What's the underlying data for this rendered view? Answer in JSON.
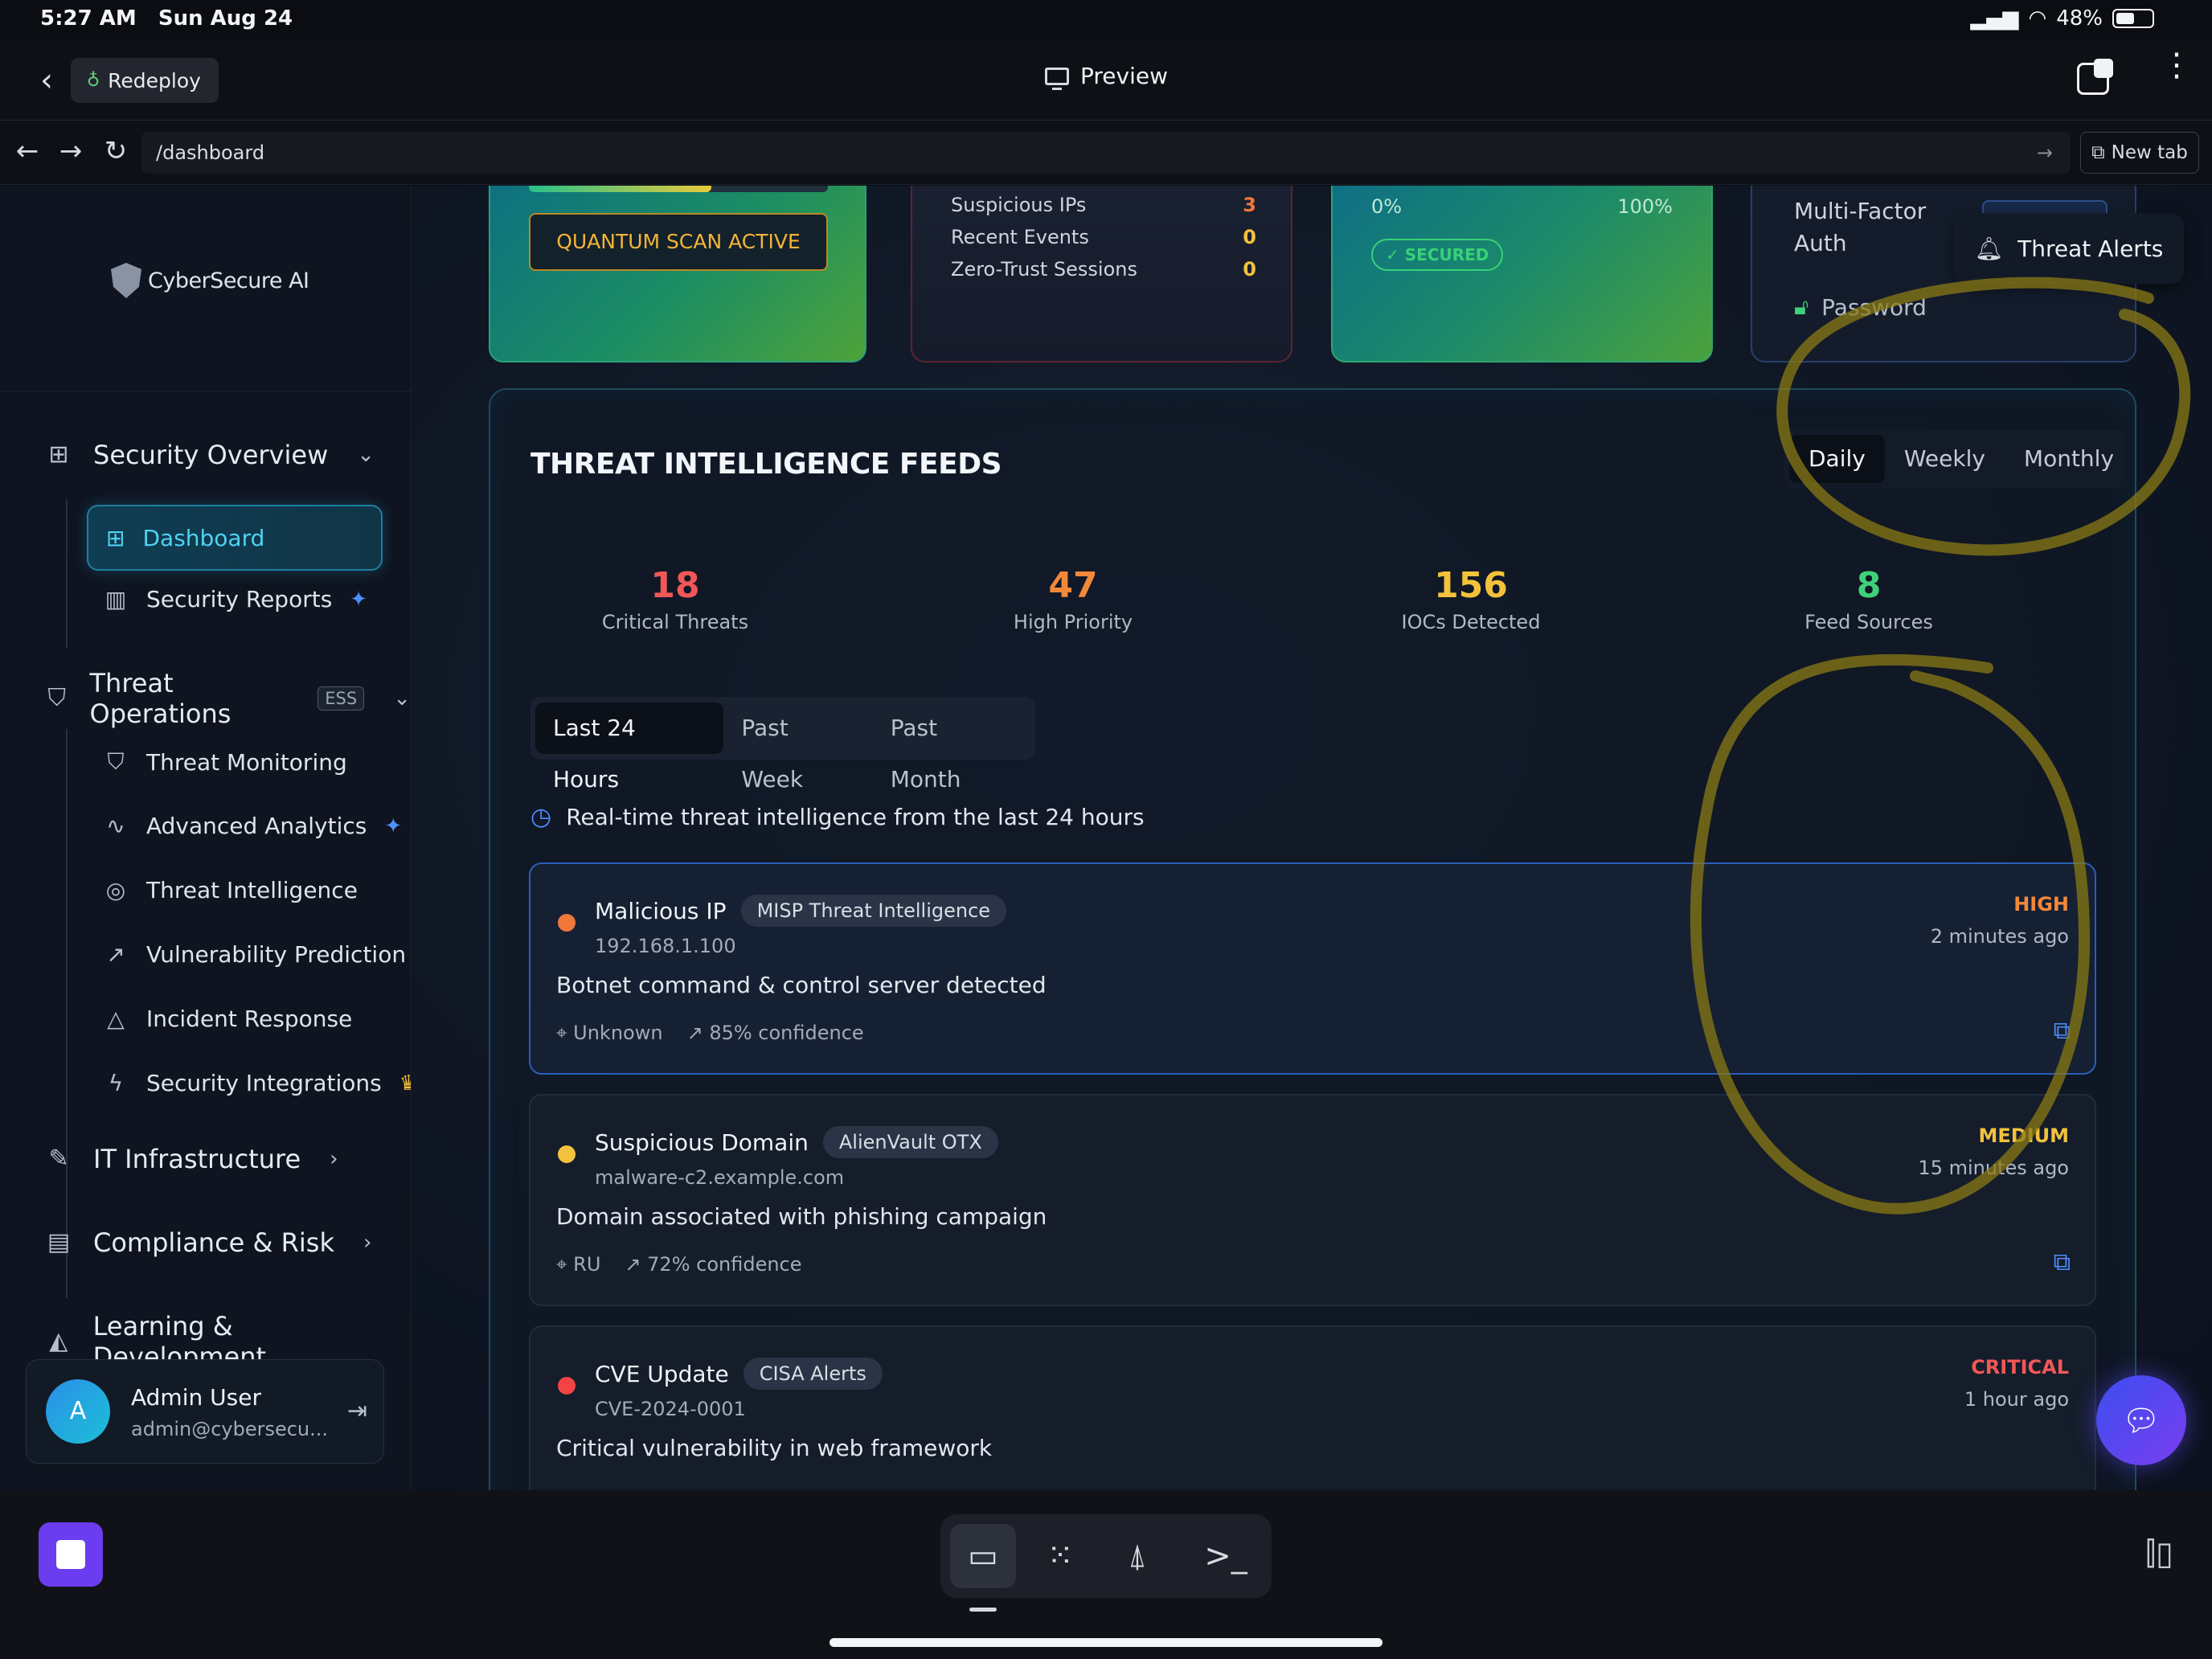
{
  "status_bar": {
    "time": "5:27 AM",
    "date": "Sun Aug 24",
    "battery": "48%"
  },
  "app_bar": {
    "back": "‹",
    "redeploy_label": "Redeploy",
    "title": "Preview"
  },
  "url_bar": {
    "url": "/dashboard",
    "new_tab_label": "New tab"
  },
  "sidebar": {
    "brand": "CyberSecure AI",
    "sections": [
      {
        "label": "Security Overview"
      },
      {
        "label": "Threat Operations",
        "badge": "ESS"
      },
      {
        "label": "IT Infrastructure"
      },
      {
        "label": "Compliance & Risk"
      },
      {
        "label": "Learning & Development"
      }
    ],
    "overview_items": [
      "Dashboard",
      "Security Reports"
    ],
    "threat_items": [
      "Threat Monitoring",
      "Advanced Analytics",
      "Threat Intelligence",
      "Vulnerability Prediction",
      "Incident Response",
      "Security Integrations"
    ],
    "user": {
      "initial": "A",
      "name": "Admin User",
      "email": "admin@cybersecu..."
    }
  },
  "top_cards": {
    "quantum": {
      "button": "QUANTUM SCAN ACTIVE",
      "progress": 0.61
    },
    "events": [
      {
        "label": "Suspicious IPs",
        "value": "3",
        "color": "#f2773a"
      },
      {
        "label": "Recent Events",
        "value": "0",
        "color": "#f2c23c"
      },
      {
        "label": "Zero-Trust Sessions",
        "value": "0",
        "color": "#f2c23c"
      }
    ],
    "secured": {
      "min": "0%",
      "max": "100%",
      "badge": "✓ SECURED"
    },
    "mfa": {
      "title": "Multi-Factor Auth",
      "password": "Password"
    }
  },
  "threat_alerts_label": "Threat Alerts",
  "feeds": {
    "title": "THREAT INTELLIGENCE FEEDS",
    "range_tabs": [
      "Daily",
      "Weekly",
      "Monthly"
    ],
    "stats": [
      {
        "value": "18",
        "label": "Critical Threats",
        "color": "#f25757"
      },
      {
        "value": "47",
        "label": "High Priority",
        "color": "#f2883a"
      },
      {
        "value": "156",
        "label": "IOCs Detected",
        "color": "#f2c23c"
      },
      {
        "value": "8",
        "label": "Feed Sources",
        "color": "#3fd178"
      }
    ],
    "period_tabs": [
      "Last 24 Hours",
      "Past Week",
      "Past Month"
    ],
    "realtime_text": "Real-time threat intelligence from the last 24 hours",
    "items": [
      {
        "type": "Malicious IP",
        "source": "MISP Threat Intelligence",
        "ioc": "192.168.1.100",
        "description": "Botnet command & control server detected",
        "location": "Unknown",
        "confidence": "85% confidence",
        "severity": "HIGH",
        "severity_color": "#f2883a",
        "dot_color": "#f2773a",
        "time": "2 minutes ago"
      },
      {
        "type": "Suspicious Domain",
        "source": "AlienVault OTX",
        "ioc": "malware-c2.example.com",
        "description": "Domain associated with phishing campaign",
        "location": "RU",
        "confidence": "72% confidence",
        "severity": "MEDIUM",
        "severity_color": "#f2c23c",
        "dot_color": "#f2c23c",
        "time": "15 minutes ago"
      },
      {
        "type": "CVE Update",
        "source": "CISA Alerts",
        "ioc": "CVE-2024-0001",
        "description": "Critical vulnerability in web framework",
        "location": "",
        "confidence": "",
        "severity": "CRITICAL",
        "severity_color": "#f25757",
        "dot_color": "#f24444",
        "time": "1 hour ago"
      }
    ]
  },
  "dock": {
    "items": [
      "desktop-icon",
      "apps-icon",
      "deploy-icon",
      "terminal-icon"
    ]
  }
}
